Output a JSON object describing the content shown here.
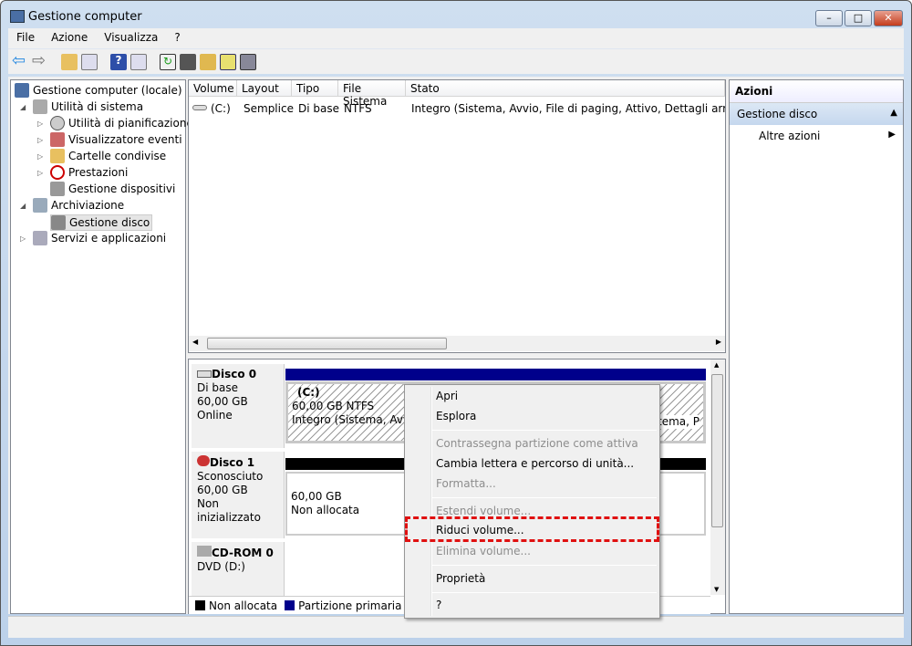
{
  "window": {
    "title": "Gestione computer"
  },
  "menu": [
    "File",
    "Azione",
    "Visualizza",
    "?"
  ],
  "tree": {
    "root": "Gestione computer (locale)",
    "utilita": "Utilità di sistema",
    "items": [
      "Utilità di pianificazione",
      "Visualizzatore eventi",
      "Cartelle condivise",
      "Prestazioni",
      "Gestione dispositivi"
    ],
    "archiviazione": "Archiviazione",
    "gestione_disco": "Gestione disco",
    "servizi": "Servizi e applicazioni"
  },
  "volumes": {
    "headers": [
      "Volume",
      "Layout",
      "Tipo",
      "File Sistema",
      "Stato"
    ],
    "rows": [
      {
        "volume": "(C:)",
        "layout": "Semplice",
        "tipo": "Di base",
        "fs": "NTFS",
        "stato": "Integro (Sistema, Avvio, File di paging, Attivo, Dettagli arresto anomalo"
      }
    ]
  },
  "disks": [
    {
      "name": "Disco 0",
      "type": "Di base",
      "size": "60,00 GB",
      "status": "Online",
      "part": {
        "label": "(C:)",
        "size": "60,00 GB NTFS",
        "state": "Integro (Sistema, Avvio,",
        "state_right": "stema, P"
      }
    },
    {
      "name": "Disco 1",
      "type": "Sconosciuto",
      "size": "60,00 GB",
      "status": "Non inizializzato",
      "part": {
        "size": "60,00 GB",
        "state": "Non allocata"
      }
    },
    {
      "name": "CD-ROM 0",
      "type": "DVD (D:)"
    }
  ],
  "legend": [
    "Non allocata",
    "Partizione primaria"
  ],
  "actions": {
    "title": "Azioni",
    "section": "Gestione disco",
    "more": "Altre azioni"
  },
  "context_menu": [
    "Apri",
    "Esplora",
    "Contrassegna partizione come attiva",
    "Cambia lettera e percorso di unità...",
    "Formatta...",
    "Estendi volume...",
    "Riduci volume...",
    "Elimina volume...",
    "Proprietà",
    "?"
  ],
  "colors": {
    "primary": "#00008b",
    "unallocated": "#000000",
    "highlight": "#e01010"
  }
}
